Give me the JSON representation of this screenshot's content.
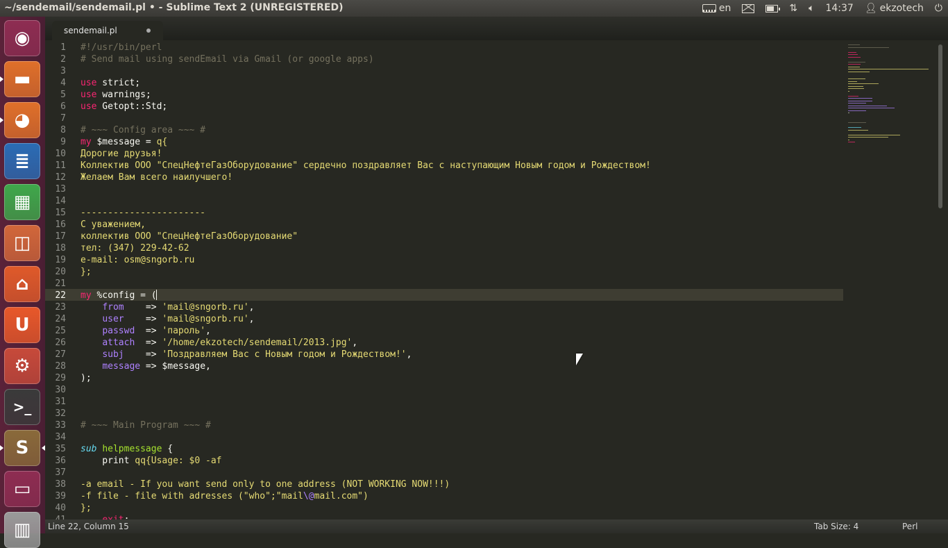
{
  "window": {
    "title": "~/sendemail/sendemail.pl • - Sublime Text 2 (UNREGISTERED)"
  },
  "indicators": {
    "keyboard_layout": "en",
    "time": "14:37",
    "user": "ekzotech",
    "battery_level": 0.7
  },
  "launcher": {
    "items": [
      {
        "name": "dash-home-icon",
        "bg": "#8e2d52",
        "glyph": "◉",
        "pip": false
      },
      {
        "name": "files-icon",
        "bg": "#e0702a",
        "glyph": "▬",
        "pip": true
      },
      {
        "name": "firefox-icon",
        "bg": "#e0702a",
        "glyph": "◕",
        "pip": true
      },
      {
        "name": "writer-icon",
        "bg": "#2a6cb5",
        "glyph": "≣",
        "pip": false
      },
      {
        "name": "calc-icon",
        "bg": "#3fa84b",
        "glyph": "▦",
        "pip": false
      },
      {
        "name": "impress-icon",
        "bg": "#d2673a",
        "glyph": "◫",
        "pip": false
      },
      {
        "name": "software-center-icon",
        "bg": "#e05a2a",
        "glyph": "⌂",
        "pip": false
      },
      {
        "name": "ubuntu-one-icon",
        "bg": "#e8582a",
        "glyph": "U",
        "pip": false
      },
      {
        "name": "system-settings-icon",
        "bg": "#c74a3a",
        "glyph": "⚙",
        "pip": false
      },
      {
        "name": "terminal-icon",
        "bg": "#3a3a3a",
        "glyph": ">_",
        "pip": false
      },
      {
        "name": "sublime-text-icon",
        "bg": "#8a6a3a",
        "glyph": "S",
        "pip": true,
        "active": true
      },
      {
        "name": "workspace-switcher-icon",
        "bg": "#8e2d52",
        "glyph": "▭",
        "pip": false
      },
      {
        "name": "trash-icon",
        "bg": "#9a9a9a",
        "glyph": "▥",
        "pip": false
      }
    ]
  },
  "tab": {
    "label": "sendemail.pl"
  },
  "editor": {
    "current_line": 22,
    "lines": [
      {
        "n": "1",
        "t": [
          {
            "c": "c",
            "v": "#!/usr/bin/perl"
          }
        ]
      },
      {
        "n": "2",
        "t": [
          {
            "c": "c",
            "v": "# Send mail using sendEmail via Gmail (or google apps)"
          }
        ]
      },
      {
        "n": "3",
        "t": []
      },
      {
        "n": "4",
        "t": [
          {
            "c": "k",
            "v": "use"
          },
          {
            "c": "",
            "v": " strict;"
          }
        ]
      },
      {
        "n": "5",
        "t": [
          {
            "c": "k",
            "v": "use"
          },
          {
            "c": "",
            "v": " warnings;"
          }
        ]
      },
      {
        "n": "6",
        "t": [
          {
            "c": "k",
            "v": "use"
          },
          {
            "c": "",
            "v": " Getopt::Std;"
          }
        ]
      },
      {
        "n": "7",
        "t": []
      },
      {
        "n": "8",
        "t": [
          {
            "c": "c",
            "v": "# ~~~ Config area ~~~ #"
          }
        ]
      },
      {
        "n": "9",
        "t": [
          {
            "c": "k",
            "v": "my"
          },
          {
            "c": "",
            "v": " $message = "
          },
          {
            "c": "s",
            "v": "q{"
          }
        ]
      },
      {
        "n": "10",
        "t": [
          {
            "c": "s",
            "v": "Дорогие друзья!"
          }
        ]
      },
      {
        "n": "11",
        "t": [
          {
            "c": "s",
            "v": "Коллектив ООО \"СпецНефтеГазОборудование\" сердечно поздравляет Вас с наступающим Новым годом и Рождеством!"
          }
        ]
      },
      {
        "n": "12",
        "t": [
          {
            "c": "s",
            "v": "Желаем Вам всего наилучшего!"
          }
        ]
      },
      {
        "n": "13",
        "t": []
      },
      {
        "n": "14",
        "t": []
      },
      {
        "n": "15",
        "t": [
          {
            "c": "s",
            "v": "-----------------------"
          }
        ]
      },
      {
        "n": "16",
        "t": [
          {
            "c": "s",
            "v": "С уважением,"
          }
        ]
      },
      {
        "n": "17",
        "t": [
          {
            "c": "s",
            "v": "коллектив ООО \"СпецНефтеГазОборудование\""
          }
        ]
      },
      {
        "n": "18",
        "t": [
          {
            "c": "s",
            "v": "тел: (347) 229-42-62"
          }
        ]
      },
      {
        "n": "19",
        "t": [
          {
            "c": "s",
            "v": "e-mail: osm@sngorb.ru"
          }
        ]
      },
      {
        "n": "20",
        "t": [
          {
            "c": "s",
            "v": "};"
          }
        ]
      },
      {
        "n": "21",
        "t": []
      },
      {
        "n": "22",
        "t": [
          {
            "c": "k",
            "v": "my"
          },
          {
            "c": "",
            "v": " %config = ("
          }
        ]
      },
      {
        "n": "23",
        "t": [
          {
            "c": "",
            "v": "    "
          },
          {
            "c": "v",
            "v": "from"
          },
          {
            "c": "",
            "v": "    => "
          },
          {
            "c": "s",
            "v": "'mail@sngorb.ru'"
          },
          {
            "c": "",
            "v": ","
          }
        ]
      },
      {
        "n": "24",
        "t": [
          {
            "c": "",
            "v": "    "
          },
          {
            "c": "v",
            "v": "user"
          },
          {
            "c": "",
            "v": "    => "
          },
          {
            "c": "s",
            "v": "'mail@sngorb.ru'"
          },
          {
            "c": "",
            "v": ","
          }
        ]
      },
      {
        "n": "25",
        "t": [
          {
            "c": "",
            "v": "    "
          },
          {
            "c": "v",
            "v": "passwd"
          },
          {
            "c": "",
            "v": "  => "
          },
          {
            "c": "s",
            "v": "'пароль'"
          },
          {
            "c": "",
            "v": ","
          }
        ]
      },
      {
        "n": "26",
        "t": [
          {
            "c": "",
            "v": "    "
          },
          {
            "c": "v",
            "v": "attach"
          },
          {
            "c": "",
            "v": "  => "
          },
          {
            "c": "s",
            "v": "'/home/ekzotech/sendemail/2013.jpg'"
          },
          {
            "c": "",
            "v": ","
          }
        ]
      },
      {
        "n": "27",
        "t": [
          {
            "c": "",
            "v": "    "
          },
          {
            "c": "v",
            "v": "subj"
          },
          {
            "c": "",
            "v": "    => "
          },
          {
            "c": "s",
            "v": "'Поздравляем Вас с Новым годом и Рождеством!'"
          },
          {
            "c": "",
            "v": ","
          }
        ]
      },
      {
        "n": "28",
        "t": [
          {
            "c": "",
            "v": "    "
          },
          {
            "c": "v",
            "v": "message"
          },
          {
            "c": "",
            "v": " => $message,"
          }
        ]
      },
      {
        "n": "29",
        "t": [
          {
            "c": "",
            "v": ");"
          }
        ]
      },
      {
        "n": "30",
        "t": []
      },
      {
        "n": "31",
        "t": []
      },
      {
        "n": "32",
        "t": []
      },
      {
        "n": "33",
        "t": [
          {
            "c": "c",
            "v": "# ~~~ Main Program ~~~ #"
          }
        ]
      },
      {
        "n": "34",
        "t": []
      },
      {
        "n": "35",
        "t": [
          {
            "c": "i",
            "v": "sub"
          },
          {
            "c": "",
            "v": " "
          },
          {
            "c": "f",
            "v": "helpmessage"
          },
          {
            "c": "",
            "v": " {"
          }
        ]
      },
      {
        "n": "36",
        "t": [
          {
            "c": "",
            "v": "    print "
          },
          {
            "c": "s",
            "v": "qq{Usage: $0 -af"
          }
        ]
      },
      {
        "n": "37",
        "t": []
      },
      {
        "n": "38",
        "t": [
          {
            "c": "s",
            "v": "-a email - If you want send only to one address (NOT WORKING NOW!!!)"
          }
        ]
      },
      {
        "n": "39",
        "t": [
          {
            "c": "s",
            "v": "-f file - file with adresses (\"who\";\"mail"
          },
          {
            "c": "e",
            "v": "\\@"
          },
          {
            "c": "s",
            "v": "mail.com\")"
          }
        ]
      },
      {
        "n": "40",
        "t": [
          {
            "c": "s",
            "v": "};"
          }
        ]
      },
      {
        "n": "41",
        "t": [
          {
            "c": "",
            "v": "    "
          },
          {
            "c": "k",
            "v": "exit"
          },
          {
            "c": "",
            "v": ";"
          }
        ]
      }
    ]
  },
  "status": {
    "position": "Line 22, Column 15",
    "tab_size": "Tab Size: 4",
    "syntax": "Perl"
  },
  "colors": {
    "comment": "#75715e",
    "keyword": "#f92672",
    "string": "#e6db74",
    "constant": "#ae81ff",
    "function": "#a6e22e",
    "storage": "#66d9ef",
    "background": "#272822"
  }
}
